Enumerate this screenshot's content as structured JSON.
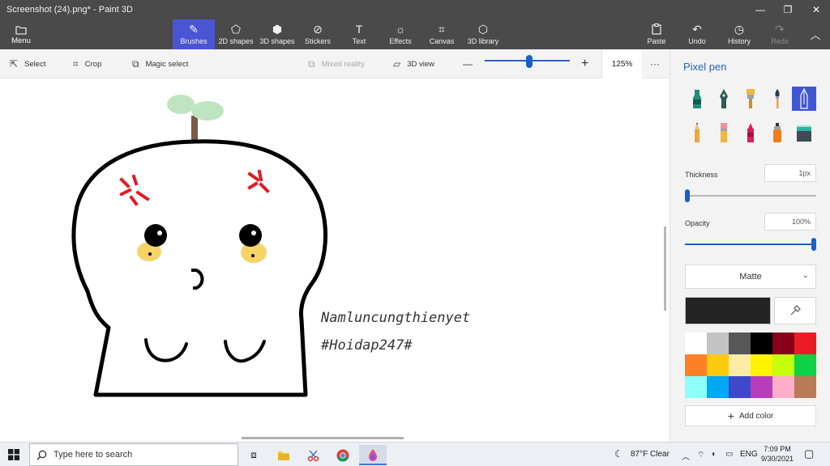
{
  "window": {
    "title": "Screenshot (24).png* - Paint 3D",
    "minimize_glyph": "—",
    "restore_glyph": "❐",
    "close_glyph": "✕"
  },
  "ribbon": {
    "menu_label": "Menu",
    "tools": [
      {
        "label": "Brushes",
        "icon": "brush-icon",
        "glyph": "✎"
      },
      {
        "label": "2D shapes",
        "icon": "2d-shapes-icon",
        "glyph": "⬠"
      },
      {
        "label": "3D shapes",
        "icon": "3d-shapes-icon",
        "glyph": "⬢"
      },
      {
        "label": "Stickers",
        "icon": "stickers-icon",
        "glyph": "⊘"
      },
      {
        "label": "Text",
        "icon": "text-icon",
        "glyph": "T"
      },
      {
        "label": "Effects",
        "icon": "effects-icon",
        "glyph": "☼"
      },
      {
        "label": "Canvas",
        "icon": "canvas-icon",
        "glyph": "⌗"
      },
      {
        "label": "3D library",
        "icon": "3d-library-icon",
        "glyph": "⬡"
      }
    ],
    "paste_label": "Paste",
    "undo_label": "Undo",
    "history_label": "History",
    "redo_label": "Redo",
    "collapse_glyph": "︿"
  },
  "toolbar": {
    "select_label": "Select",
    "crop_label": "Crop",
    "magic_select_label": "Magic select",
    "mixed_reality_label": "Mixed reality",
    "view3d_label": "3D view",
    "zoom_out_glyph": "—",
    "zoom_in_glyph": "+",
    "zoom_value": "125%",
    "zoom_fraction": 0.52,
    "more_glyph": "···"
  },
  "canvas": {
    "caption_line1": "Namluncungthienyet",
    "caption_line2": "#Hoidap247#"
  },
  "panel": {
    "title": "Pixel pen",
    "thickness_label": "Thickness",
    "thickness_value": "1px",
    "thickness_fraction": 0.0,
    "opacity_label": "Opacity",
    "opacity_value": "100%",
    "opacity_fraction": 1.0,
    "finish": "Matte",
    "current_color": "#232323",
    "add_color_label": "Add color",
    "palette": [
      "#ffffff",
      "#c3c3c3",
      "#585858",
      "#000000",
      "#88001b",
      "#ec1c24",
      "#ff7f27",
      "#ffc90e",
      "#fdeca6",
      "#fff200",
      "#c4ff0e",
      "#0ed145",
      "#8cfffb",
      "#00a8f3",
      "#3f48cc",
      "#b83dba",
      "#ffaec8",
      "#b97a56"
    ],
    "accent": "#2660c4"
  },
  "taskbar": {
    "search_placeholder": "Type here to search",
    "weather": "87°F  Clear",
    "language": "ENG",
    "time": "7:09 PM",
    "date": "9/30/2021"
  }
}
